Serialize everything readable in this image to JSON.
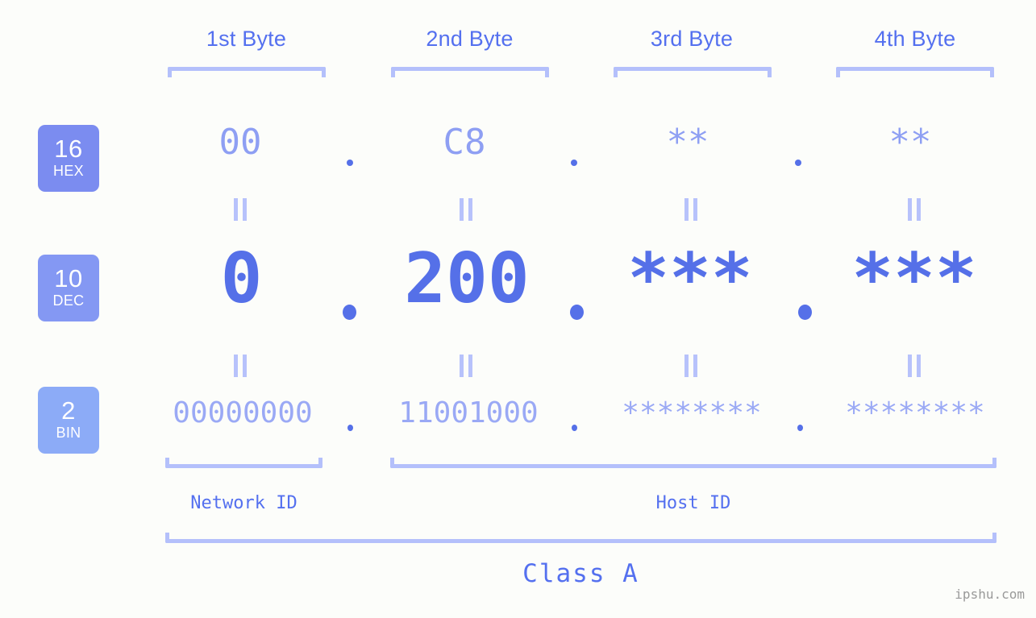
{
  "watermark": "ipshu.com",
  "byte_headers": [
    {
      "label": "1st Byte"
    },
    {
      "label": "2nd Byte"
    },
    {
      "label": "3rd Byte"
    },
    {
      "label": "4th Byte"
    }
  ],
  "rows": [
    {
      "badge_number": "16",
      "badge_name": "HEX",
      "badge_color": "#7b8cf0",
      "values": [
        "00",
        "C8",
        "**",
        "**"
      ]
    },
    {
      "badge_number": "10",
      "badge_name": "DEC",
      "badge_color": "#8498f3",
      "values": [
        "0",
        "200",
        "***",
        "***"
      ]
    },
    {
      "badge_number": "2",
      "badge_name": "BIN",
      "badge_color": "#8cabf7",
      "values": [
        "00000000",
        "11001000",
        "********",
        "********"
      ]
    }
  ],
  "separators": {
    "dot": "."
  },
  "id_labels": [
    {
      "label": "Network ID"
    },
    {
      "label": "Host ID"
    }
  ],
  "class_label": "Class A",
  "colors": {
    "background": "#fcfdfa",
    "accent_strong": "#5570e8",
    "accent_mid": "#8e9ff3",
    "accent_light": "#b4c0fb",
    "header_text": "#5470ef",
    "watermark_text": "#9a9a9a"
  }
}
